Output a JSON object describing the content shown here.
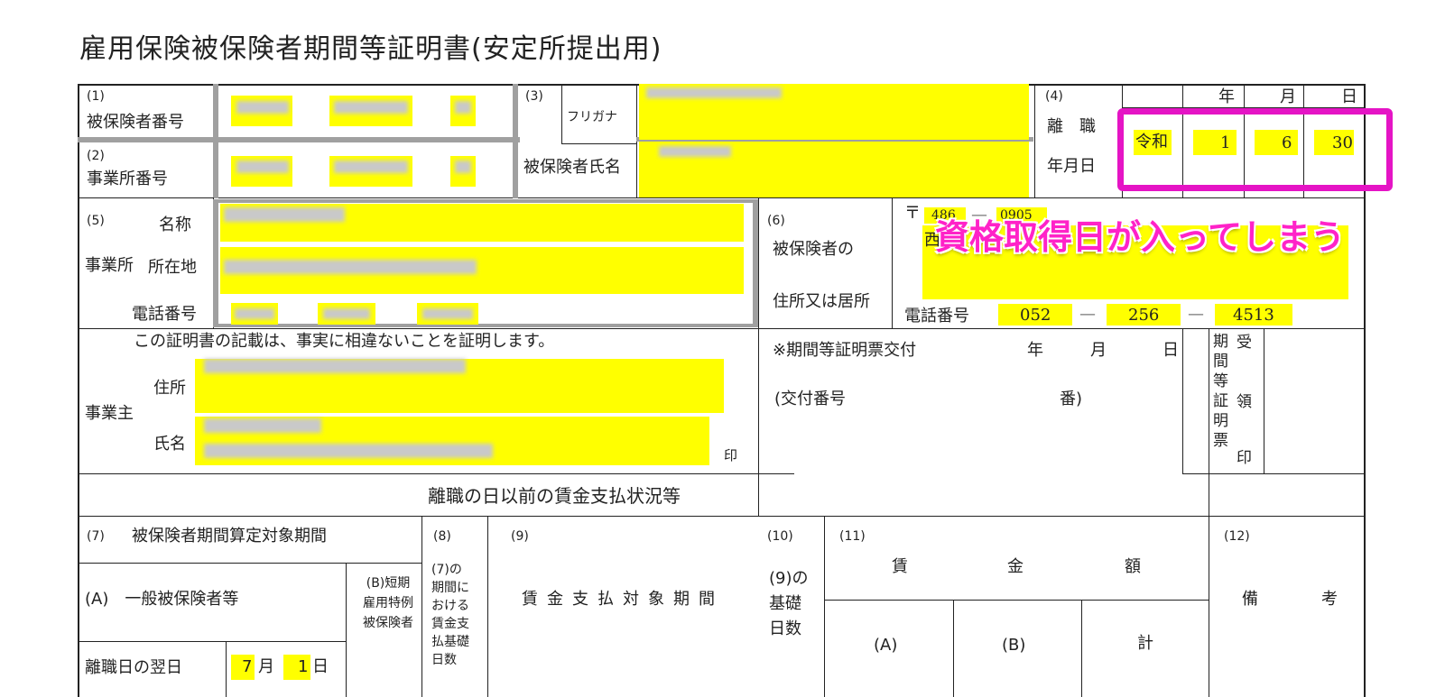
{
  "title": "雇用保険被保険者期間等証明書(安定所提出用)",
  "f1": {
    "num": "(1)",
    "label": "被保険者番号"
  },
  "f2": {
    "num": "(2)",
    "label": "事業所番号"
  },
  "f3": {
    "num": "(3)",
    "furigana": "フリガナ",
    "label": "被保険者氏名"
  },
  "f4": {
    "num": "(4)",
    "label1": "離　職",
    "label2": "年月日",
    "era": "令和",
    "year": "1",
    "month": "6",
    "day": "30",
    "h_year": "年",
    "h_month": "月",
    "h_day": "日"
  },
  "f5": {
    "num": "(5)",
    "name_label": "名称",
    "jigyosho": "事業所",
    "address_label": "所在地",
    "phone_label": "電話番号"
  },
  "f6": {
    "num": "(6)",
    "label1": "被保険者の",
    "label2": "住所又は居所",
    "postal_mark": "〒",
    "postal1": "486",
    "dash": "—",
    "postal2": "0905",
    "addr_char": "西",
    "phone_label": "電話番号",
    "phone1": "052",
    "phone2": "256",
    "phone3": "4513"
  },
  "cert": {
    "statement": "この証明書の記載は、事実に相違ないことを証明します。",
    "employer": "事業主",
    "address": "住所",
    "name": "氏名",
    "seal": "印"
  },
  "issue": {
    "label": "※期間等証明票交付",
    "year": "年",
    "month": "月",
    "day": "日",
    "number_open": "(交付番号",
    "number_close": "番)",
    "receipt_vert": [
      "期",
      "間",
      "等",
      "証",
      "明",
      "票"
    ],
    "receipt_vert2": [
      "受",
      "領",
      "印"
    ]
  },
  "section_title": "離職の日以前の賃金支払状況等",
  "f7": {
    "num": "(7)",
    "label": "被保険者期間算定対象期間",
    "A": "(A)　一般被保険者等",
    "B": [
      "(B)短期",
      "雇用特例",
      "被保険者"
    ],
    "next_day": "離職日の翌日",
    "month": "7",
    "month_unit": "月",
    "day": "1",
    "day_unit": "日"
  },
  "f8": {
    "num": "(8)",
    "lines": [
      "(7)の",
      "期間に",
      "おける",
      "賃金支",
      "払基礎",
      "日数"
    ]
  },
  "f9": {
    "num": "(9)",
    "label": "賃金支払対象期間"
  },
  "f10": {
    "num": "(10)",
    "lines": [
      "(9)の",
      "基礎",
      "日数"
    ]
  },
  "f11": {
    "num": "(11)",
    "c1": "賃",
    "c2": "金",
    "c3": "額",
    "A": "(A)",
    "B": "(B)",
    "total": "計"
  },
  "f12": {
    "num": "(12)",
    "c1": "備",
    "c2": "考"
  },
  "annotation": "資格取得日が入ってしまう"
}
